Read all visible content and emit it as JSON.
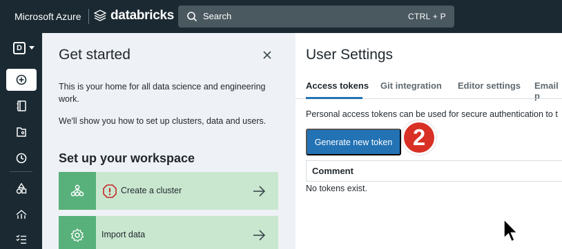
{
  "topbar": {
    "brand_azure": "Microsoft Azure",
    "brand_databricks": "databricks",
    "search_placeholder": "Search",
    "search_shortcut": "CTRL + P"
  },
  "leftnav": {
    "persona_letter": "D",
    "items": [
      "new",
      "workspace",
      "repos",
      "recents",
      "data",
      "compute",
      "workflows"
    ],
    "active_item": "new"
  },
  "get_started": {
    "title": "Get started",
    "intro": "This is your home for all data science and engineering work.",
    "intro2": "We'll show you how to set up clusters, data and users.",
    "subtitle": "Set up your workspace",
    "cards": [
      {
        "label": "Create a cluster",
        "icon": "cluster-icon",
        "status_icon": "warning-icon"
      },
      {
        "label": "Import data",
        "icon": "gear-icon"
      }
    ]
  },
  "user_settings": {
    "title": "User Settings",
    "tabs": [
      "Access tokens",
      "Git integration",
      "Editor settings",
      "Email p"
    ],
    "active_tab": "Access tokens",
    "description": "Personal access tokens can be used for secure authentication to t",
    "generate_button": "Generate new token",
    "step_number": "2",
    "table_header": "Comment",
    "empty_text": "No tokens exist."
  },
  "colors": {
    "topbar_bg": "#1b2a32",
    "panel_bg": "#eef1f5",
    "card_bg": "#c9e7cf",
    "card_icon_bg": "#58b07a",
    "primary": "#2272b4",
    "badge": "#d93025"
  }
}
